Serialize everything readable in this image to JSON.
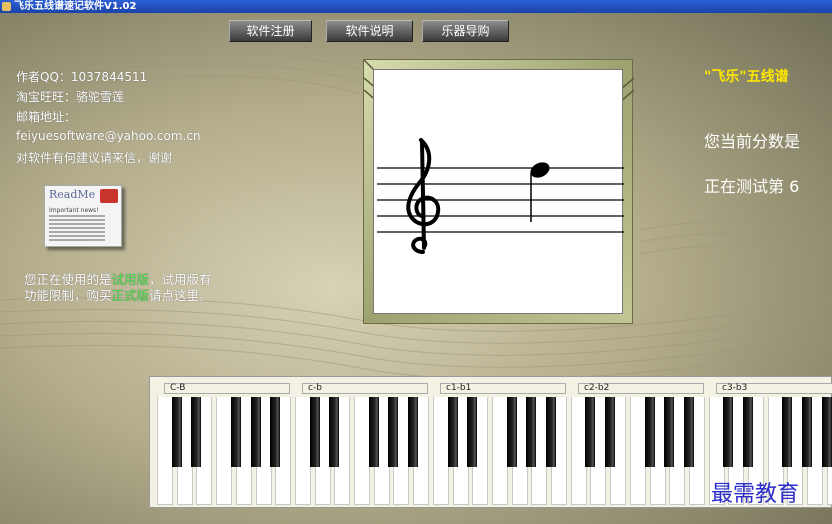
{
  "window": {
    "title": "飞乐五线谱速记软件V1.02"
  },
  "toolbar": {
    "register_label": "软件注册",
    "manual_label": "软件说明",
    "shop_label": "乐器导购"
  },
  "author_info": {
    "qq": "作者QQ：1037844511",
    "taobao": "淘宝旺旺：骆驼雪莲",
    "email_label": "邮箱地址：",
    "email": "feiyuesoftware@yahoo.com.cn",
    "suggestion": "对软件有何建议请来信，谢谢"
  },
  "readme": {
    "title": "ReadMe",
    "subtitle": "Important news!"
  },
  "trial_notice": {
    "part1": "您正在使用的是",
    "highlight1": "试用版",
    "part2": "，试用版有功能限制，购买",
    "highlight2": "正式版",
    "part3": "请点这里。"
  },
  "right_panel": {
    "title": "\"飞乐\"五线谱",
    "score_text": "您当前分数是",
    "test_text": "正在测试第 6"
  },
  "keyboard": {
    "octaves": [
      "C-B",
      "c-b",
      "c1-b1",
      "c2-b2",
      "c3-b3"
    ]
  },
  "watermark": "最需教育",
  "colors": {
    "highlight": "#4be04b",
    "right_title": "#ffe800",
    "watermark": "#2d2dc9"
  }
}
